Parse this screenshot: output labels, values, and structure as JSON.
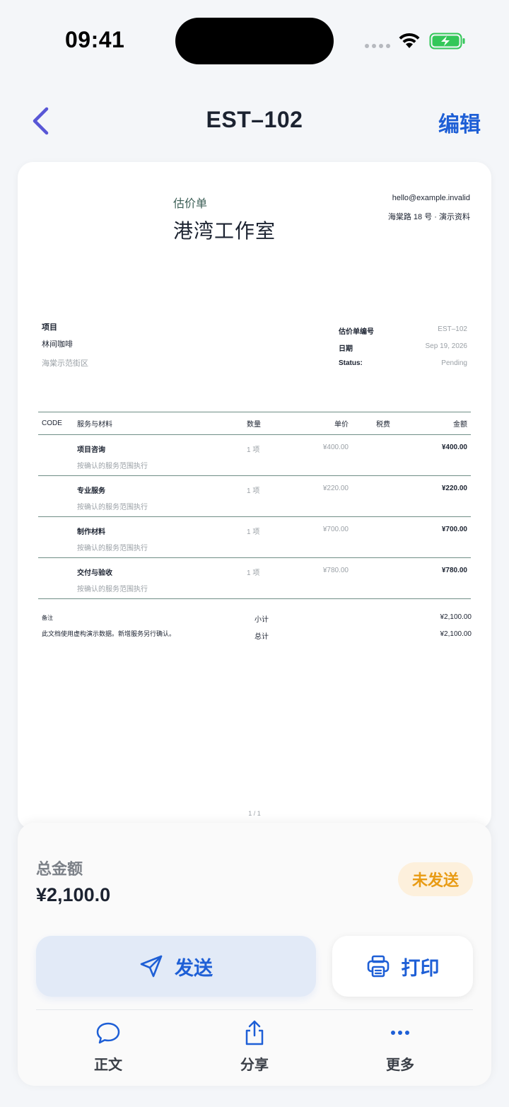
{
  "status_bar": {
    "time": "09:41"
  },
  "nav": {
    "title": "EST–102",
    "edit_label": "编辑"
  },
  "document": {
    "type_label": "估价单",
    "company": "港湾工作室",
    "email": "hello@example.invalid",
    "address": "海棠路 18 号 · 演示资料",
    "project_label": "项目",
    "project_name": "林间咖啡",
    "project_address": "海棠示范街区",
    "meta": [
      {
        "key": "估价单编号",
        "value": "EST–102"
      },
      {
        "key": "日期",
        "value": "Sep 19, 2026"
      },
      {
        "key": "Status:",
        "value": "Pending"
      }
    ],
    "table_headers": {
      "code": "CODE",
      "desc": "服务与材料",
      "qty": "数量",
      "unit": "单价",
      "tax": "税费",
      "amount": "金额"
    },
    "items": [
      {
        "name": "项目咨询",
        "desc": "按确认的服务范围执行",
        "qty": "1 项",
        "unit": "¥400.00",
        "amount": "¥400.00"
      },
      {
        "name": "专业服务",
        "desc": "按确认的服务范围执行",
        "qty": "1 项",
        "unit": "¥220.00",
        "amount": "¥220.00"
      },
      {
        "name": "制作材料",
        "desc": "按确认的服务范围执行",
        "qty": "1 项",
        "unit": "¥700.00",
        "amount": "¥700.00"
      },
      {
        "name": "交付与验收",
        "desc": "按确认的服务范围执行",
        "qty": "1 项",
        "unit": "¥780.00",
        "amount": "¥780.00"
      }
    ],
    "notes_label": "备注",
    "notes_text": "此文档使用虚构演示数据。新增服务另行确认。",
    "totals": [
      {
        "label": "小计",
        "value": "¥2,100.00"
      },
      {
        "label": "总计",
        "value": "¥2,100.00"
      }
    ],
    "page": "1 / 1"
  },
  "summary": {
    "total_label": "总金额",
    "total_value": "¥2,100.0",
    "status": "未发送",
    "status_color": "#e89b14"
  },
  "actions": {
    "send_label": "发送",
    "print_label": "打印"
  },
  "tabs": [
    {
      "label": "正文",
      "icon": "chat-bubble-icon"
    },
    {
      "label": "分享",
      "icon": "share-icon"
    },
    {
      "label": "更多",
      "icon": "more-icon"
    }
  ],
  "colors": {
    "accent": "#1e5fd6",
    "back": "#5856d6",
    "battery": "#34c759"
  }
}
